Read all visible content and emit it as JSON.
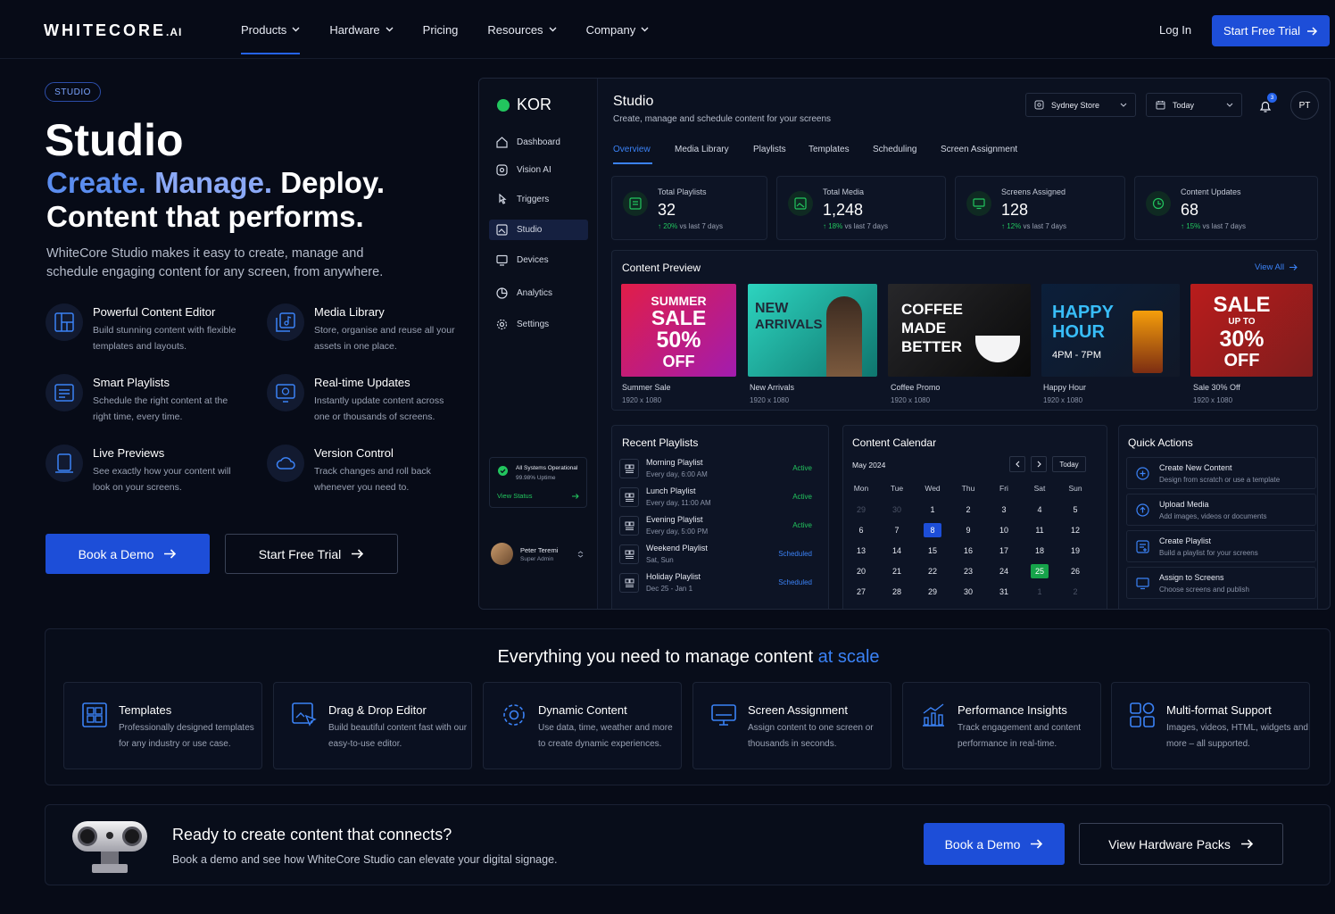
{
  "nav": {
    "logo_main": "WHITECORE",
    "logo_suffix": ".AI",
    "items": [
      "Products",
      "Hardware",
      "Pricing",
      "Resources",
      "Company"
    ],
    "login": "Log In",
    "trial": "Start Free Trial"
  },
  "hero": {
    "badge": "STUDIO",
    "title": "Studio",
    "tag_a": "Create.",
    "tag_b": "Manage.",
    "tag_c": "Deploy.",
    "tag_line2": "Content that performs.",
    "lead": "WhiteCore Studio makes it easy to create, manage and schedule engaging content for any screen, from anywhere.",
    "features": [
      {
        "title": "Powerful Content Editor",
        "desc": "Build stunning content with flexible templates and layouts."
      },
      {
        "title": "Media Library",
        "desc": "Store, organise and reuse all your assets in one place."
      },
      {
        "title": "Smart Playlists",
        "desc": "Schedule the right content at the right time, every time."
      },
      {
        "title": "Real-time Updates",
        "desc": "Instantly update content across one or thousands of screens."
      },
      {
        "title": "Live Previews",
        "desc": "See exactly how your content will look on your screens."
      },
      {
        "title": "Version Control",
        "desc": "Track changes and roll back whenever you need to."
      }
    ],
    "demo": "Book a Demo",
    "trial": "Start Free Trial"
  },
  "app": {
    "brand": "KOR",
    "sidebar": [
      "Dashboard",
      "Vision AI",
      "Triggers",
      "Studio",
      "Devices",
      "Analytics",
      "Settings"
    ],
    "system": {
      "title": "All Systems Operational",
      "uptime": "99.98% Uptime",
      "link": "View Status"
    },
    "user": {
      "name": "Peter Teremi",
      "role": "Super Admin"
    },
    "header": {
      "title": "Studio",
      "subtitle": "Create, manage and schedule content for your screens",
      "store": "Sydney Store",
      "date": "Today",
      "notif_count": "3",
      "initials": "PT"
    },
    "tabs": [
      "Overview",
      "Media Library",
      "Playlists",
      "Templates",
      "Scheduling",
      "Screen Assignment"
    ],
    "stats": [
      {
        "label": "Total Playlists",
        "value": "32",
        "change": "20%",
        "suffix": "vs last 7 days"
      },
      {
        "label": "Total Media",
        "value": "1,248",
        "change": "18%",
        "suffix": "vs last 7 days"
      },
      {
        "label": "Screens Assigned",
        "value": "128",
        "change": "12%",
        "suffix": "vs last 7 days"
      },
      {
        "label": "Content Updates",
        "value": "68",
        "change": "15%",
        "suffix": "vs last 7 days"
      }
    ],
    "preview": {
      "title": "Content Preview",
      "view_all": "View All",
      "items": [
        {
          "name": "Summer Sale",
          "size": "1920 x 1080",
          "l1": "SUMMER",
          "l2": "SALE",
          "l3": "50%",
          "l4": "OFF"
        },
        {
          "name": "New Arrivals",
          "size": "1920 x 1080",
          "l1": "NEW",
          "l2": "ARRIVALS"
        },
        {
          "name": "Coffee Promo",
          "size": "1920 x 1080",
          "l1": "COFFEE",
          "l2": "MADE",
          "l3": "BETTER"
        },
        {
          "name": "Happy Hour",
          "size": "1920 x 1080",
          "l1": "HAPPY",
          "l2": "HOUR",
          "l3": "4PM - 7PM"
        },
        {
          "name": "Sale 30% Off",
          "size": "1920 x 1080",
          "l1": "SALE",
          "l2": "UP TO",
          "l3": "30%",
          "l4": "OFF"
        }
      ]
    },
    "playlists": {
      "title": "Recent Playlists",
      "items": [
        {
          "name": "Morning Playlist",
          "sched": "Every day, 6:00 AM",
          "status": "Active"
        },
        {
          "name": "Lunch Playlist",
          "sched": "Every day, 11:00 AM",
          "status": "Active"
        },
        {
          "name": "Evening Playlist",
          "sched": "Every day, 5:00 PM",
          "status": "Active"
        },
        {
          "name": "Weekend Playlist",
          "sched": "Sat, Sun",
          "status": "Scheduled"
        },
        {
          "name": "Holiday Playlist",
          "sched": "Dec 25 - Jan 1",
          "status": "Scheduled"
        }
      ]
    },
    "calendar": {
      "title": "Content Calendar",
      "month": "May 2024",
      "today": "Today",
      "days": [
        "Mon",
        "Tue",
        "Wed",
        "Thu",
        "Fri",
        "Sat",
        "Sun"
      ],
      "weeks": [
        [
          "29",
          "30",
          "1",
          "2",
          "3",
          "4",
          "5"
        ],
        [
          "6",
          "7",
          "8",
          "9",
          "10",
          "11",
          "12"
        ],
        [
          "13",
          "14",
          "15",
          "16",
          "17",
          "18",
          "19"
        ],
        [
          "20",
          "21",
          "22",
          "23",
          "24",
          "25",
          "26"
        ],
        [
          "27",
          "28",
          "29",
          "30",
          "31",
          "1",
          "2"
        ]
      ]
    },
    "quick": {
      "title": "Quick Actions",
      "items": [
        {
          "name": "Create New Content",
          "desc": "Design from scratch or use a template"
        },
        {
          "name": "Upload Media",
          "desc": "Add images, videos or documents"
        },
        {
          "name": "Create Playlist",
          "desc": "Build a playlist for your screens"
        },
        {
          "name": "Assign to Screens",
          "desc": "Choose screens and publish"
        }
      ]
    }
  },
  "strip": {
    "title_a": "Everything you need to manage content",
    "title_b": "at scale",
    "cards": [
      {
        "title": "Templates",
        "desc": "Professionally designed templates for any industry or use case."
      },
      {
        "title": "Drag & Drop Editor",
        "desc": "Build beautiful content fast with our easy-to-use editor."
      },
      {
        "title": "Dynamic Content",
        "desc": "Use data, time, weather and more to create dynamic experiences."
      },
      {
        "title": "Screen Assignment",
        "desc": "Assign content to one screen or thousands in seconds."
      },
      {
        "title": "Performance Insights",
        "desc": "Track engagement and content performance in real-time."
      },
      {
        "title": "Multi-format Support",
        "desc": "Images, videos, HTML, widgets and more – all supported."
      }
    ]
  },
  "cta": {
    "title": "Ready to create content that connects?",
    "desc": "Book a demo and see how WhiteCore Studio can elevate your digital signage.",
    "demo": "Book a Demo",
    "hardware": "View Hardware Packs"
  },
  "colors": {
    "accent": "#1d4ed8",
    "active_green": "#22c55e",
    "scheduled_blue": "#3b82f6"
  }
}
